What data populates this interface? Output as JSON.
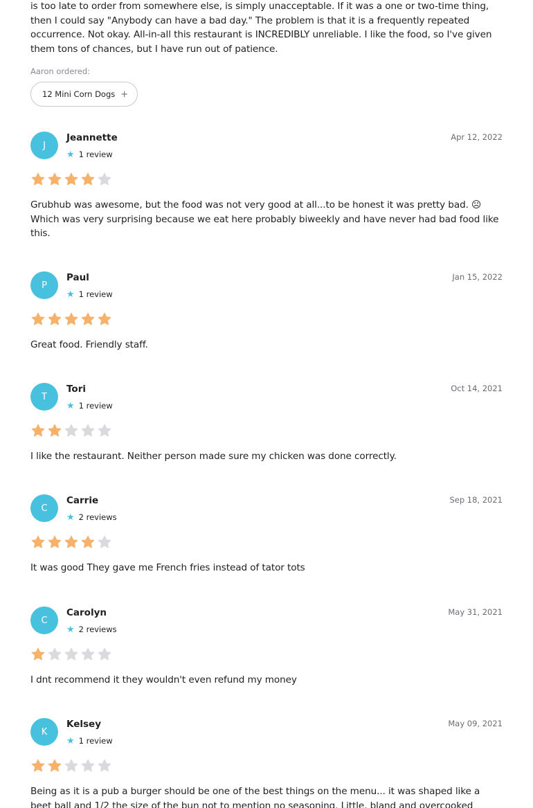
{
  "top_review": {
    "text": "is too late to order from somewhere else, is simply unacceptable. If it was a one or two-time thing, then I could say \"Anybody can have a bad day.\" The problem is that it is a frequently repeated occurrence. Not okay. All-in-all this restaurant is INCREDIBLY unreliable. I like the food, so I've given them tons of chances, but I have run out of patience.",
    "ordered_label": "Aaron ordered:",
    "ordered_item": "12 Mini Corn Dogs",
    "ordered_item_icon": "plus-icon"
  },
  "colors": {
    "avatar": "#47c1dd",
    "star_filled": "#f6b26b",
    "star_empty": "#d9d9de",
    "count_star": "#47c1dd"
  },
  "reviews": [
    {
      "initial": "J",
      "name": "Jeannette",
      "count": "1 review",
      "date": "Apr 12, 2022",
      "rating": 4,
      "text": "Grubhub was awesome, but the food was not very good at all...to be honest it was pretty bad. ☹ Which was very surprising because we eat here probably biweekly and have never had bad food like this."
    },
    {
      "initial": "P",
      "name": "Paul",
      "count": "1 review",
      "date": "Jan 15, 2022",
      "rating": 5,
      "text": "Great food. Friendly staff."
    },
    {
      "initial": "T",
      "name": "Tori",
      "count": "1 review",
      "date": "Oct 14, 2021",
      "rating": 2,
      "text": "I like the restaurant. Neither person made sure my chicken was done correctly."
    },
    {
      "initial": "C",
      "name": "Carrie",
      "count": "2 reviews",
      "date": "Sep 18, 2021",
      "rating": 4,
      "text": "It was good They gave me French fries instead of tator tots"
    },
    {
      "initial": "C",
      "name": "Carolyn",
      "count": "2 reviews",
      "date": "May 31, 2021",
      "rating": 1,
      "text": "I dnt recommend it they wouldn't even refund my money"
    },
    {
      "initial": "K",
      "name": "Kelsey",
      "count": "1 review",
      "date": "May 09, 2021",
      "rating": 2,
      "text": "Being as it is a pub a burger should be one of the best things on the menu... it was shaped like a beet ball and 1/2 the size of the bun not to mention no seasoning. Little, bland and overcooked beyond the bun..."
    }
  ]
}
